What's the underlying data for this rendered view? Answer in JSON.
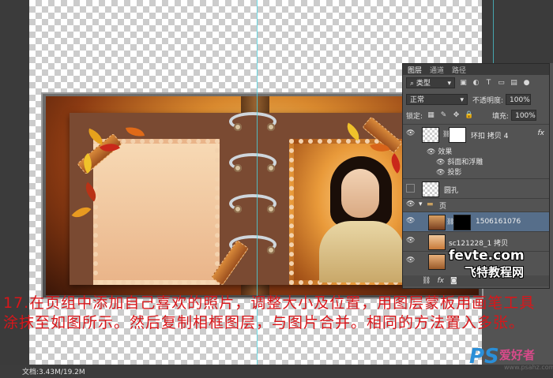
{
  "layers_panel": {
    "tabs": [
      "图层",
      "通道",
      "路径"
    ],
    "filter_kind": "类型",
    "blend_mode": "正常",
    "opacity_label": "不透明度:",
    "opacity_value": "100%",
    "lock_label": "锁定:",
    "fill_label": "填充:",
    "fill_value": "100%",
    "layers": [
      {
        "name": "环扣 拷贝 4",
        "fx": "fx"
      },
      {
        "name": "效果"
      },
      {
        "name": "斜面和浮雕"
      },
      {
        "name": "投影"
      },
      {
        "name": "圆孔"
      },
      {
        "name": "页"
      },
      {
        "name": "1506161076"
      },
      {
        "name": "sc121228_1 拷贝"
      }
    ]
  },
  "instruction": {
    "text": "17.在页组中添加自己喜欢的照片，调整大小及位置，用图层蒙板用画笔工具涂抹至如图所示。然后复制相框图层，与图片合并。相同的方法置入多张。"
  },
  "status_bar": {
    "doc_size": "文档:3.43M/19.2M"
  },
  "watermarks": {
    "fevte": "fevte.com",
    "fevte_cn": "飞特教程网",
    "ps_mark": "PS",
    "ps_cn": "爱好者",
    "ps_url": "www.psahz.com"
  },
  "colors": {
    "instruction_text": "#d9161a",
    "selected_layer": "#566e8a",
    "guide": "#4ad3e0"
  }
}
